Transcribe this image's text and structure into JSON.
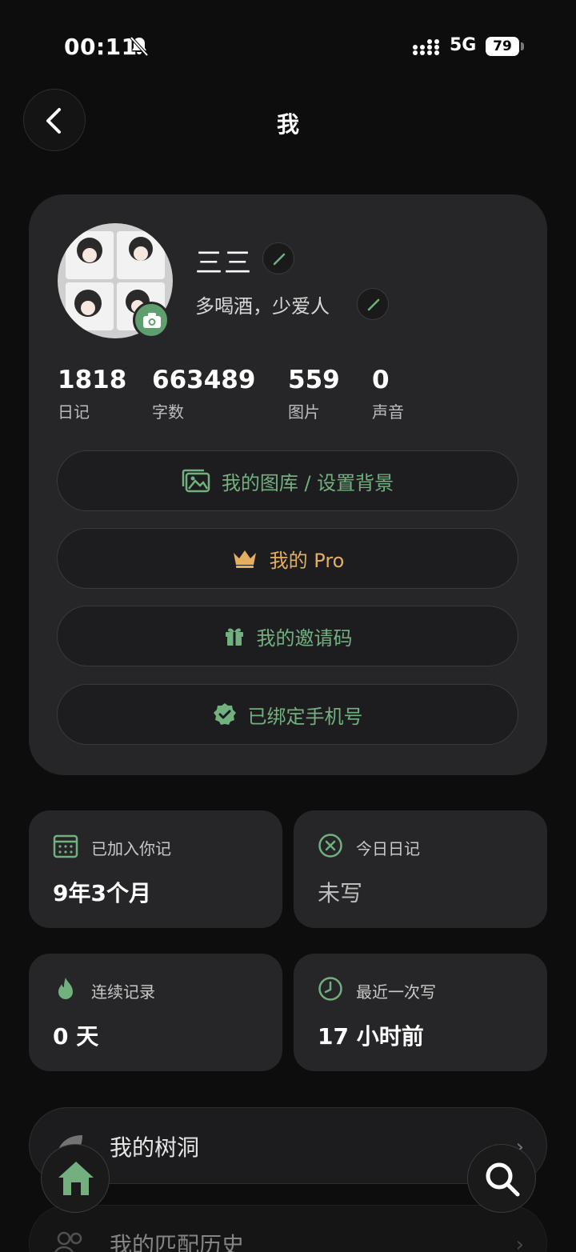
{
  "status_bar": {
    "time": "00:11",
    "network": "5G",
    "battery": "79"
  },
  "header": {
    "title": "我"
  },
  "profile": {
    "nickname": "三三",
    "bio": "多喝酒，少爱人",
    "stats": [
      {
        "value": "1818",
        "label": "日记"
      },
      {
        "value": "663489",
        "label": "字数"
      },
      {
        "value": "559",
        "label": "图片"
      },
      {
        "value": "0",
        "label": "声音"
      }
    ],
    "buttons": {
      "gallery": "我的图库 / 设置背景",
      "pro": "我的 Pro",
      "invite": "我的邀请码",
      "phone": "已绑定手机号"
    }
  },
  "tiles": {
    "joined": {
      "label": "已加入你记",
      "value": "9年3个月"
    },
    "today": {
      "label": "今日日记",
      "value": "未写"
    },
    "streak": {
      "label": "连续记录",
      "value": "0 天"
    },
    "last": {
      "label": "最近一次写",
      "value": "17 小时前"
    }
  },
  "list": {
    "treehole": "我的树洞",
    "match_history": "我的匹配历史"
  },
  "colors": {
    "accent_green": "#72b07f",
    "pro_gold": "#e3ae5d",
    "card_bg": "#262628"
  },
  "icons": [
    "back-arrow-icon",
    "bell-muted-icon",
    "camera-icon",
    "pencil-icon",
    "gallery-icon",
    "crown-icon",
    "gift-icon",
    "verified-badge-icon",
    "calendar-icon",
    "close-circle-icon",
    "flame-icon",
    "clock-icon",
    "leaf-icon",
    "people-icon",
    "home-icon",
    "search-icon"
  ]
}
